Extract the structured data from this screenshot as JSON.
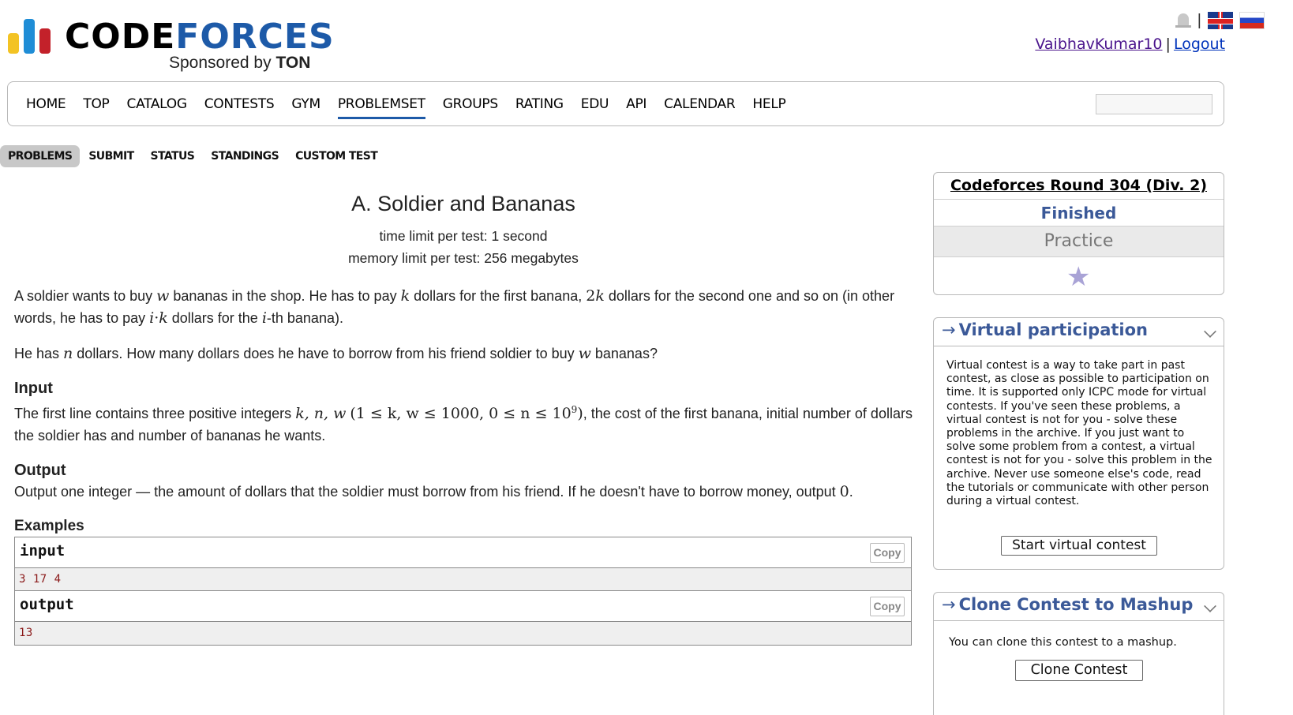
{
  "header": {
    "logo": {
      "code": "CODE",
      "forces": "FORCES",
      "sponsored_by": "Sponsored by",
      "sponsor": "TON"
    },
    "languages": [
      "English",
      "Russian"
    ],
    "separator": "|",
    "user": {
      "name": "VaibhavKumar10",
      "sep": "|",
      "logout": "Logout"
    }
  },
  "main_nav": {
    "items": [
      "HOME",
      "TOP",
      "CATALOG",
      "CONTESTS",
      "GYM",
      "PROBLEMSET",
      "GROUPS",
      "RATING",
      "EDU",
      "API",
      "CALENDAR",
      "HELP"
    ],
    "active": "PROBLEMSET",
    "search_value": ""
  },
  "sub_nav": {
    "items": [
      "PROBLEMS",
      "SUBMIT",
      "STATUS",
      "STANDINGS",
      "CUSTOM TEST"
    ],
    "active": "PROBLEMS"
  },
  "problem": {
    "title": "A. Soldier and Bananas",
    "time_limit": "time limit per test: 1 second",
    "memory_limit": "memory limit per test: 256 megabytes",
    "statement_1": {
      "a": "A soldier wants to buy ",
      "w": "w",
      "b": " bananas in the shop. He has to pay ",
      "k": "k",
      "c": " dollars for the first banana, ",
      "twok_num": "2",
      "twok_var": "k",
      "d": " dollars for the second one and so on (in other words, he has to pay ",
      "ik_i": "i",
      "ik_dot": "·",
      "ik_k": "k",
      "e": " dollars for the ",
      "ith_i": "i",
      "f": "-th banana)."
    },
    "statement_2": {
      "a": "He has ",
      "n": "n",
      "b": " dollars. How many dollars does he have to borrow from his friend soldier to buy ",
      "w": "w",
      "c": " bananas?"
    },
    "input_title": "Input",
    "input_text": {
      "a": "The first line contains three positive integers ",
      "vars": "k, n, w",
      "cons": "(1 ≤ k, w ≤ 1000, 0 ≤ n ≤ 10",
      "exp": "9",
      "close": ")",
      "b": ", the cost of the first banana, initial number of dollars the soldier has and number of bananas he wants."
    },
    "output_title": "Output",
    "output_text": {
      "a": "Output one integer — the amount of dollars that the soldier must borrow from his friend. If he doesn't have to borrow money, output ",
      "zero": "0",
      "b": "."
    },
    "examples_title": "Examples",
    "examples": {
      "input_label": "input",
      "input_value": "3 17 4",
      "output_label": "output",
      "output_value": "13",
      "copy_label": "Copy"
    }
  },
  "sidebar": {
    "contest": {
      "name": "Codeforces Round 304 (Div. 2)",
      "status": "Finished",
      "mode": "Practice",
      "star_icon": "star-icon"
    },
    "virtual": {
      "arrow": "→",
      "title": "Virtual participation",
      "text": "Virtual contest is a way to take part in past contest, as close as possible to participation on time. It is supported only ICPC mode for virtual contests. If you've seen these problems, a virtual contest is not for you - solve these problems in the archive. If you just want to solve some problem from a contest, a virtual contest is not for you - solve this problem in the archive. Never use someone else's code, read the tutorials or communicate with other person during a virtual contest.",
      "button": "Start virtual contest"
    },
    "clone": {
      "arrow": "→",
      "title": "Clone Contest to Mashup",
      "text": "You can clone this contest to a mashup.",
      "button": "Clone Contest"
    }
  },
  "colors": {
    "brand_blue": "#1d5aa8",
    "link_purple": "#4a148c",
    "sidebar_title": "#3b5998",
    "example_value": "#8b1a1a"
  }
}
